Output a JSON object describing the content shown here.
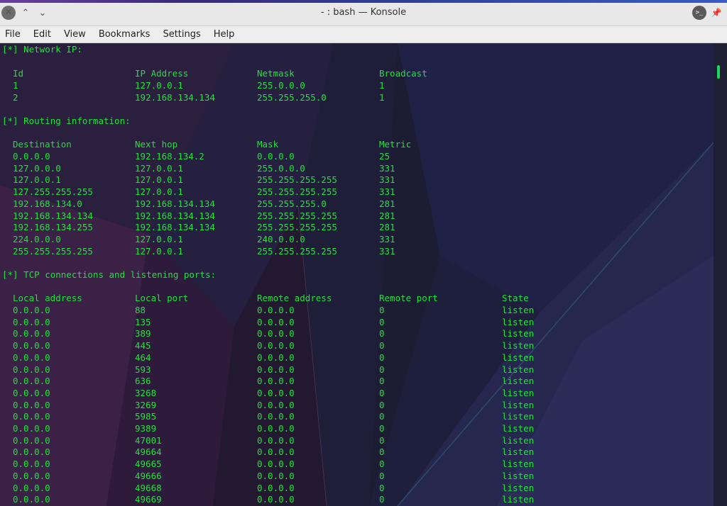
{
  "window": {
    "title": "- : bash — Konsole",
    "close_glyph": "✕",
    "up_glyph": "⌃",
    "down_glyph": "⌄",
    "terminal_glyph": ">_",
    "pin_glyph": "📌"
  },
  "menu": [
    "File",
    "Edit",
    "View",
    "Bookmarks",
    "Settings",
    "Help"
  ],
  "terminal": {
    "network_heading": "[*] Network IP:",
    "network_headers": [
      "Id",
      "IP Address",
      "Netmask",
      "Broadcast"
    ],
    "network_rows": [
      [
        "1",
        "127.0.0.1",
        "255.0.0.0",
        "1"
      ],
      [
        "2",
        "192.168.134.134",
        "255.255.255.0",
        "1"
      ]
    ],
    "routing_heading": "[*] Routing information:",
    "routing_headers": [
      "Destination",
      "Next hop",
      "Mask",
      "Metric"
    ],
    "routing_rows": [
      [
        "0.0.0.0",
        "192.168.134.2",
        "0.0.0.0",
        "25"
      ],
      [
        "127.0.0.0",
        "127.0.0.1",
        "255.0.0.0",
        "331"
      ],
      [
        "127.0.0.1",
        "127.0.0.1",
        "255.255.255.255",
        "331"
      ],
      [
        "127.255.255.255",
        "127.0.0.1",
        "255.255.255.255",
        "331"
      ],
      [
        "192.168.134.0",
        "192.168.134.134",
        "255.255.255.0",
        "281"
      ],
      [
        "192.168.134.134",
        "192.168.134.134",
        "255.255.255.255",
        "281"
      ],
      [
        "192.168.134.255",
        "192.168.134.134",
        "255.255.255.255",
        "281"
      ],
      [
        "224.0.0.0",
        "127.0.0.1",
        "240.0.0.0",
        "331"
      ],
      [
        "255.255.255.255",
        "127.0.0.1",
        "255.255.255.255",
        "331"
      ]
    ],
    "tcp_heading": "[*] TCP connections and listening ports:",
    "tcp_headers": [
      "Local address",
      "Local port",
      "Remote address",
      "Remote port",
      "State"
    ],
    "tcp_rows": [
      [
        "0.0.0.0",
        "88",
        "0.0.0.0",
        "0",
        "listen"
      ],
      [
        "0.0.0.0",
        "135",
        "0.0.0.0",
        "0",
        "listen"
      ],
      [
        "0.0.0.0",
        "389",
        "0.0.0.0",
        "0",
        "listen"
      ],
      [
        "0.0.0.0",
        "445",
        "0.0.0.0",
        "0",
        "listen"
      ],
      [
        "0.0.0.0",
        "464",
        "0.0.0.0",
        "0",
        "listen"
      ],
      [
        "0.0.0.0",
        "593",
        "0.0.0.0",
        "0",
        "listen"
      ],
      [
        "0.0.0.0",
        "636",
        "0.0.0.0",
        "0",
        "listen"
      ],
      [
        "0.0.0.0",
        "3268",
        "0.0.0.0",
        "0",
        "listen"
      ],
      [
        "0.0.0.0",
        "3269",
        "0.0.0.0",
        "0",
        "listen"
      ],
      [
        "0.0.0.0",
        "5985",
        "0.0.0.0",
        "0",
        "listen"
      ],
      [
        "0.0.0.0",
        "9389",
        "0.0.0.0",
        "0",
        "listen"
      ],
      [
        "0.0.0.0",
        "47001",
        "0.0.0.0",
        "0",
        "listen"
      ],
      [
        "0.0.0.0",
        "49664",
        "0.0.0.0",
        "0",
        "listen"
      ],
      [
        "0.0.0.0",
        "49665",
        "0.0.0.0",
        "0",
        "listen"
      ],
      [
        "0.0.0.0",
        "49666",
        "0.0.0.0",
        "0",
        "listen"
      ],
      [
        "0.0.0.0",
        "49668",
        "0.0.0.0",
        "0",
        "listen"
      ],
      [
        "0.0.0.0",
        "49669",
        "0.0.0.0",
        "0",
        "listen"
      ]
    ]
  },
  "colors": {
    "terminal_text": "#1ee43a",
    "terminal_background": "#1d1e33",
    "scrollbar_thumb": "#1ed760"
  }
}
